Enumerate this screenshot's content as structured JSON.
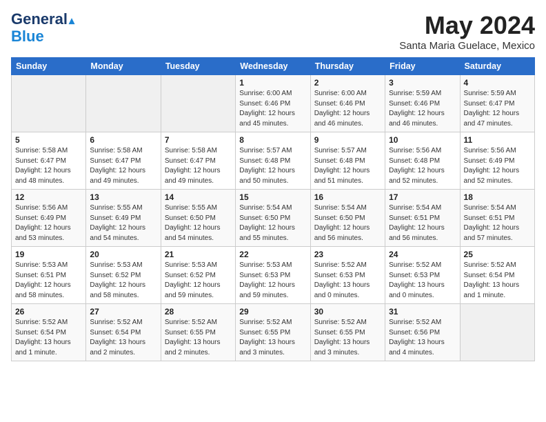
{
  "header": {
    "logo_line1": "General",
    "logo_line2": "Blue",
    "month_title": "May 2024",
    "location": "Santa Maria Guelace, Mexico"
  },
  "weekdays": [
    "Sunday",
    "Monday",
    "Tuesday",
    "Wednesday",
    "Thursday",
    "Friday",
    "Saturday"
  ],
  "weeks": [
    [
      {
        "day": "",
        "info": ""
      },
      {
        "day": "",
        "info": ""
      },
      {
        "day": "",
        "info": ""
      },
      {
        "day": "1",
        "info": "Sunrise: 6:00 AM\nSunset: 6:46 PM\nDaylight: 12 hours\nand 45 minutes."
      },
      {
        "day": "2",
        "info": "Sunrise: 6:00 AM\nSunset: 6:46 PM\nDaylight: 12 hours\nand 46 minutes."
      },
      {
        "day": "3",
        "info": "Sunrise: 5:59 AM\nSunset: 6:46 PM\nDaylight: 12 hours\nand 46 minutes."
      },
      {
        "day": "4",
        "info": "Sunrise: 5:59 AM\nSunset: 6:47 PM\nDaylight: 12 hours\nand 47 minutes."
      }
    ],
    [
      {
        "day": "5",
        "info": "Sunrise: 5:58 AM\nSunset: 6:47 PM\nDaylight: 12 hours\nand 48 minutes."
      },
      {
        "day": "6",
        "info": "Sunrise: 5:58 AM\nSunset: 6:47 PM\nDaylight: 12 hours\nand 49 minutes."
      },
      {
        "day": "7",
        "info": "Sunrise: 5:58 AM\nSunset: 6:47 PM\nDaylight: 12 hours\nand 49 minutes."
      },
      {
        "day": "8",
        "info": "Sunrise: 5:57 AM\nSunset: 6:48 PM\nDaylight: 12 hours\nand 50 minutes."
      },
      {
        "day": "9",
        "info": "Sunrise: 5:57 AM\nSunset: 6:48 PM\nDaylight: 12 hours\nand 51 minutes."
      },
      {
        "day": "10",
        "info": "Sunrise: 5:56 AM\nSunset: 6:48 PM\nDaylight: 12 hours\nand 52 minutes."
      },
      {
        "day": "11",
        "info": "Sunrise: 5:56 AM\nSunset: 6:49 PM\nDaylight: 12 hours\nand 52 minutes."
      }
    ],
    [
      {
        "day": "12",
        "info": "Sunrise: 5:56 AM\nSunset: 6:49 PM\nDaylight: 12 hours\nand 53 minutes."
      },
      {
        "day": "13",
        "info": "Sunrise: 5:55 AM\nSunset: 6:49 PM\nDaylight: 12 hours\nand 54 minutes."
      },
      {
        "day": "14",
        "info": "Sunrise: 5:55 AM\nSunset: 6:50 PM\nDaylight: 12 hours\nand 54 minutes."
      },
      {
        "day": "15",
        "info": "Sunrise: 5:54 AM\nSunset: 6:50 PM\nDaylight: 12 hours\nand 55 minutes."
      },
      {
        "day": "16",
        "info": "Sunrise: 5:54 AM\nSunset: 6:50 PM\nDaylight: 12 hours\nand 56 minutes."
      },
      {
        "day": "17",
        "info": "Sunrise: 5:54 AM\nSunset: 6:51 PM\nDaylight: 12 hours\nand 56 minutes."
      },
      {
        "day": "18",
        "info": "Sunrise: 5:54 AM\nSunset: 6:51 PM\nDaylight: 12 hours\nand 57 minutes."
      }
    ],
    [
      {
        "day": "19",
        "info": "Sunrise: 5:53 AM\nSunset: 6:51 PM\nDaylight: 12 hours\nand 58 minutes."
      },
      {
        "day": "20",
        "info": "Sunrise: 5:53 AM\nSunset: 6:52 PM\nDaylight: 12 hours\nand 58 minutes."
      },
      {
        "day": "21",
        "info": "Sunrise: 5:53 AM\nSunset: 6:52 PM\nDaylight: 12 hours\nand 59 minutes."
      },
      {
        "day": "22",
        "info": "Sunrise: 5:53 AM\nSunset: 6:53 PM\nDaylight: 12 hours\nand 59 minutes."
      },
      {
        "day": "23",
        "info": "Sunrise: 5:52 AM\nSunset: 6:53 PM\nDaylight: 13 hours\nand 0 minutes."
      },
      {
        "day": "24",
        "info": "Sunrise: 5:52 AM\nSunset: 6:53 PM\nDaylight: 13 hours\nand 0 minutes."
      },
      {
        "day": "25",
        "info": "Sunrise: 5:52 AM\nSunset: 6:54 PM\nDaylight: 13 hours\nand 1 minute."
      }
    ],
    [
      {
        "day": "26",
        "info": "Sunrise: 5:52 AM\nSunset: 6:54 PM\nDaylight: 13 hours\nand 1 minute."
      },
      {
        "day": "27",
        "info": "Sunrise: 5:52 AM\nSunset: 6:54 PM\nDaylight: 13 hours\nand 2 minutes."
      },
      {
        "day": "28",
        "info": "Sunrise: 5:52 AM\nSunset: 6:55 PM\nDaylight: 13 hours\nand 2 minutes."
      },
      {
        "day": "29",
        "info": "Sunrise: 5:52 AM\nSunset: 6:55 PM\nDaylight: 13 hours\nand 3 minutes."
      },
      {
        "day": "30",
        "info": "Sunrise: 5:52 AM\nSunset: 6:55 PM\nDaylight: 13 hours\nand 3 minutes."
      },
      {
        "day": "31",
        "info": "Sunrise: 5:52 AM\nSunset: 6:56 PM\nDaylight: 13 hours\nand 4 minutes."
      },
      {
        "day": "",
        "info": ""
      }
    ]
  ]
}
